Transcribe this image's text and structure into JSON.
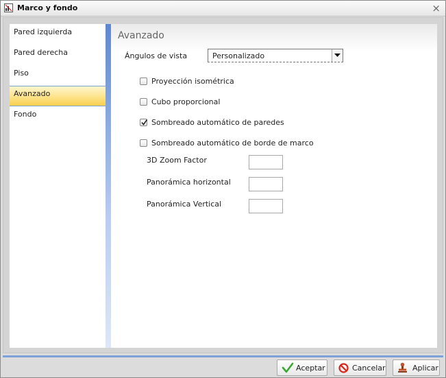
{
  "dialog": {
    "title": "Marco y fondo",
    "close_glyph": "×"
  },
  "sidebar": {
    "items": [
      {
        "label": "Pared izquierda"
      },
      {
        "label": "Pared derecha"
      },
      {
        "label": "Piso"
      },
      {
        "label": "Avanzado",
        "active": true
      },
      {
        "label": "Fondo"
      }
    ]
  },
  "panel": {
    "title": "Avanzado",
    "view_angles": {
      "label": "Ángulos de vista",
      "value": "Personalizado"
    },
    "checkboxes": [
      {
        "label": "Proyección isométrica",
        "checked": false
      },
      {
        "label": "Cubo proporcional",
        "checked": false
      },
      {
        "label": "Sombreado automático de paredes",
        "checked": true
      },
      {
        "label": "Sombreado automático de borde de marco",
        "checked": false
      }
    ],
    "fields": [
      {
        "label": "3D Zoom Factor",
        "value": ""
      },
      {
        "label": "Panorámica horizontal",
        "value": ""
      },
      {
        "label": "Panorámica Vertical",
        "value": ""
      }
    ]
  },
  "footer": {
    "accept_label": "Aceptar",
    "cancel_label": "Cancelar",
    "apply_label": "Aplicar"
  },
  "colors": {
    "accent_blue": "#6f97d6",
    "active_item": "#fde38a",
    "accept_icon": "#3aa830",
    "cancel_icon": "#d52a20"
  },
  "icons": {
    "app": "chart-app-icon",
    "close": "close-icon",
    "dropdown": "chevron-down-icon",
    "accept": "checkmark-icon",
    "cancel": "no-entry-icon",
    "apply": "stamp-icon"
  }
}
